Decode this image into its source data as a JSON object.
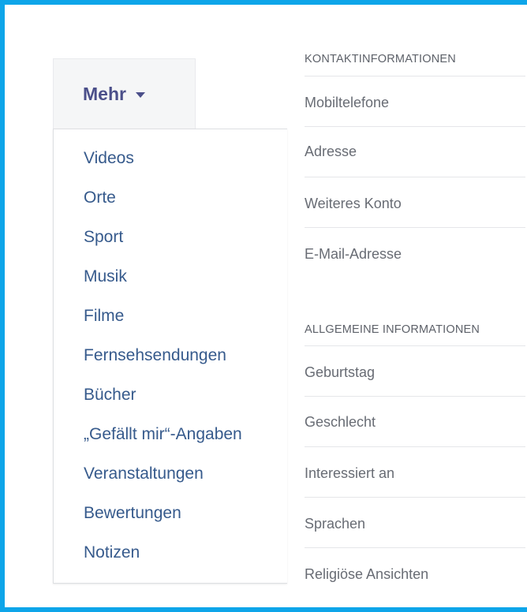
{
  "more_menu": {
    "label": "Mehr",
    "items": [
      "Videos",
      "Orte",
      "Sport",
      "Musik",
      "Filme",
      "Fernsehsendungen",
      "Bücher",
      "„Gefällt mir“-Angaben",
      "Veranstaltungen",
      "Bewertungen",
      "Notizen"
    ]
  },
  "contact": {
    "title": "KONTAKTINFORMATIONEN",
    "rows": [
      "Mobiltelefone",
      "Adresse",
      "Weiteres Konto",
      "E-Mail-Adresse"
    ]
  },
  "general": {
    "title": "ALLGEMEINE INFORMATIONEN",
    "rows": [
      "Geburtstag",
      "Geschlecht",
      "Interessiert an",
      "Sprachen",
      "Religiöse Ansichten"
    ]
  },
  "colors": {
    "frame_border": "#0ea5e9",
    "link": "#365a8c",
    "mehr": "#4b4f8a"
  }
}
